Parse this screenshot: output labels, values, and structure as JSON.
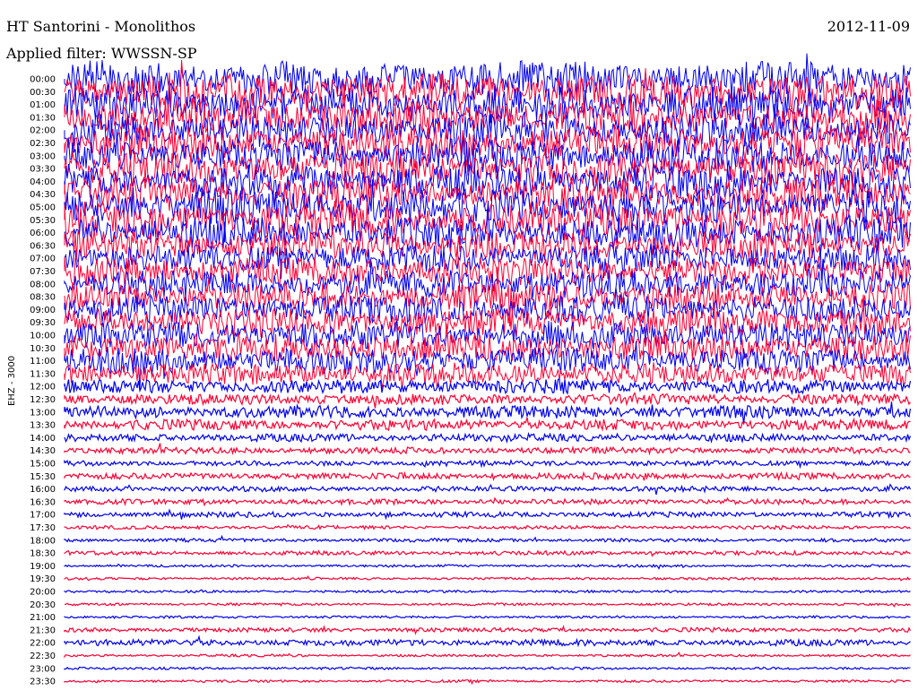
{
  "header": {
    "station": "HT Santorini - Monolithos",
    "date": "2012-11-09",
    "filter": "Applied filter: WWSSN-SP"
  },
  "chart_data": {
    "type": "line",
    "title": "HT Santorini - Monolithos",
    "subtitle": "Applied filter: WWSSN-SP",
    "date": "2012-11-09",
    "channel_label": "EHZ - 3000",
    "ylabel": "EHZ - 3000",
    "xlabel": "",
    "colors": [
      "#0000ee",
      "#ff0033"
    ],
    "rows": [
      {
        "time": "00:00",
        "amplitude": 1.0
      },
      {
        "time": "00:30",
        "amplitude": 1.0
      },
      {
        "time": "01:00",
        "amplitude": 1.0
      },
      {
        "time": "01:30",
        "amplitude": 1.0
      },
      {
        "time": "02:00",
        "amplitude": 0.95
      },
      {
        "time": "02:30",
        "amplitude": 0.95
      },
      {
        "time": "03:00",
        "amplitude": 0.95
      },
      {
        "time": "03:30",
        "amplitude": 0.95
      },
      {
        "time": "04:00",
        "amplitude": 0.95
      },
      {
        "time": "04:30",
        "amplitude": 0.95
      },
      {
        "time": "05:00",
        "amplitude": 1.0
      },
      {
        "time": "05:30",
        "amplitude": 1.0
      },
      {
        "time": "06:00",
        "amplitude": 0.9
      },
      {
        "time": "06:30",
        "amplitude": 0.85
      },
      {
        "time": "07:00",
        "amplitude": 0.8
      },
      {
        "time": "07:30",
        "amplitude": 0.8
      },
      {
        "time": "08:00",
        "amplitude": 0.8
      },
      {
        "time": "08:30",
        "amplitude": 0.8
      },
      {
        "time": "09:00",
        "amplitude": 0.8
      },
      {
        "time": "09:30",
        "amplitude": 0.8
      },
      {
        "time": "10:00",
        "amplitude": 0.8
      },
      {
        "time": "10:30",
        "amplitude": 0.8
      },
      {
        "time": "11:00",
        "amplitude": 0.75
      },
      {
        "time": "11:30",
        "amplitude": 0.6
      },
      {
        "time": "12:00",
        "amplitude": 0.4
      },
      {
        "time": "12:30",
        "amplitude": 0.3
      },
      {
        "time": "13:00",
        "amplitude": 0.35
      },
      {
        "time": "13:30",
        "amplitude": 0.3
      },
      {
        "time": "14:00",
        "amplitude": 0.22
      },
      {
        "time": "14:30",
        "amplitude": 0.18
      },
      {
        "time": "15:00",
        "amplitude": 0.15
      },
      {
        "time": "15:30",
        "amplitude": 0.18
      },
      {
        "time": "16:00",
        "amplitude": 0.15
      },
      {
        "time": "16:30",
        "amplitude": 0.15
      },
      {
        "time": "17:00",
        "amplitude": 0.15
      },
      {
        "time": "17:30",
        "amplitude": 0.1
      },
      {
        "time": "18:00",
        "amplitude": 0.1
      },
      {
        "time": "18:30",
        "amplitude": 0.12
      },
      {
        "time": "19:00",
        "amplitude": 0.07
      },
      {
        "time": "19:30",
        "amplitude": 0.07
      },
      {
        "time": "20:00",
        "amplitude": 0.07
      },
      {
        "time": "20:30",
        "amplitude": 0.07
      },
      {
        "time": "21:00",
        "amplitude": 0.07
      },
      {
        "time": "21:30",
        "amplitude": 0.12
      },
      {
        "time": "22:00",
        "amplitude": 0.18
      },
      {
        "time": "22:30",
        "amplitude": 0.07
      },
      {
        "time": "23:00",
        "amplitude": 0.07
      },
      {
        "time": "23:30",
        "amplitude": 0.07
      }
    ]
  }
}
